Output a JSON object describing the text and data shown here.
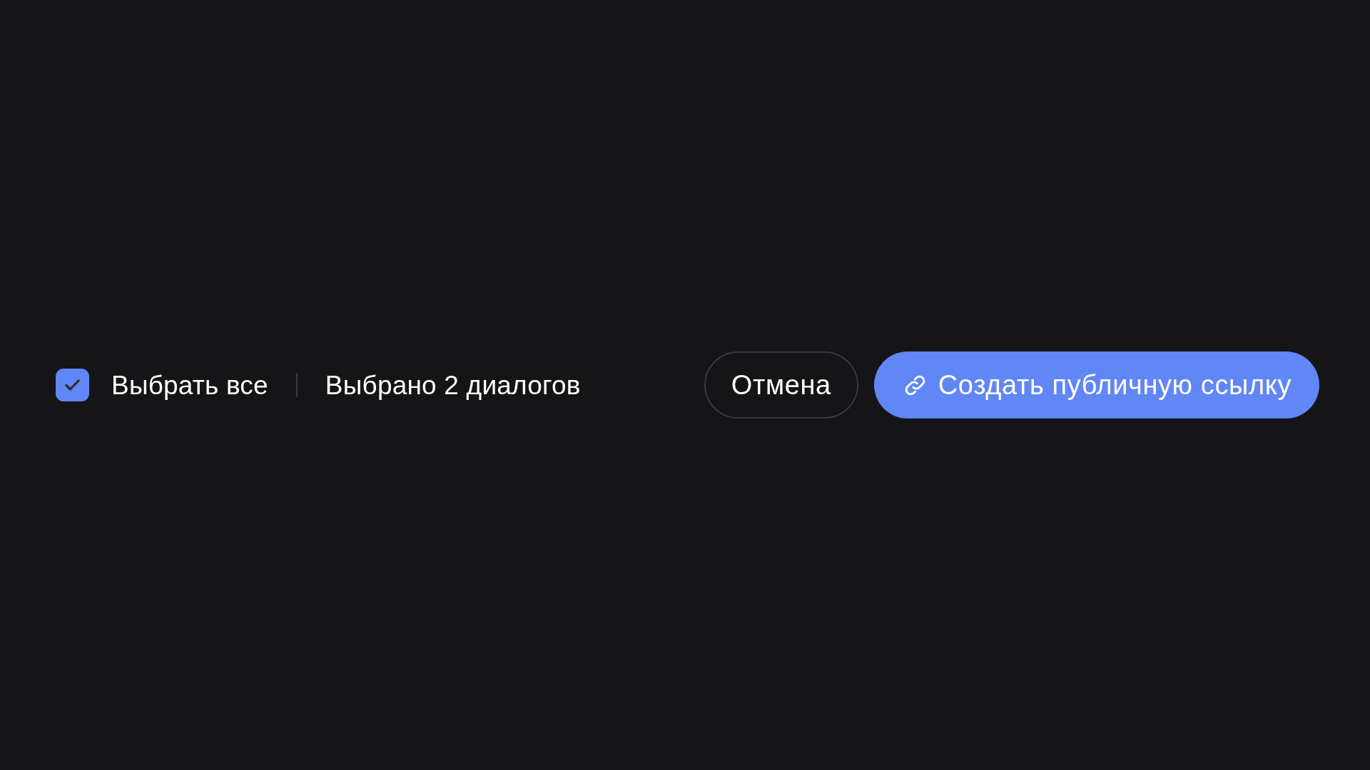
{
  "selection_bar": {
    "select_all": {
      "label": "Выбрать все",
      "checked": true
    },
    "selection_count": "Выбрано 2 диалогов",
    "buttons": [
      {
        "label": "Отмена",
        "kind": "secondary"
      },
      {
        "label": "Создать публичную ссылку",
        "kind": "primary"
      }
    ]
  }
}
